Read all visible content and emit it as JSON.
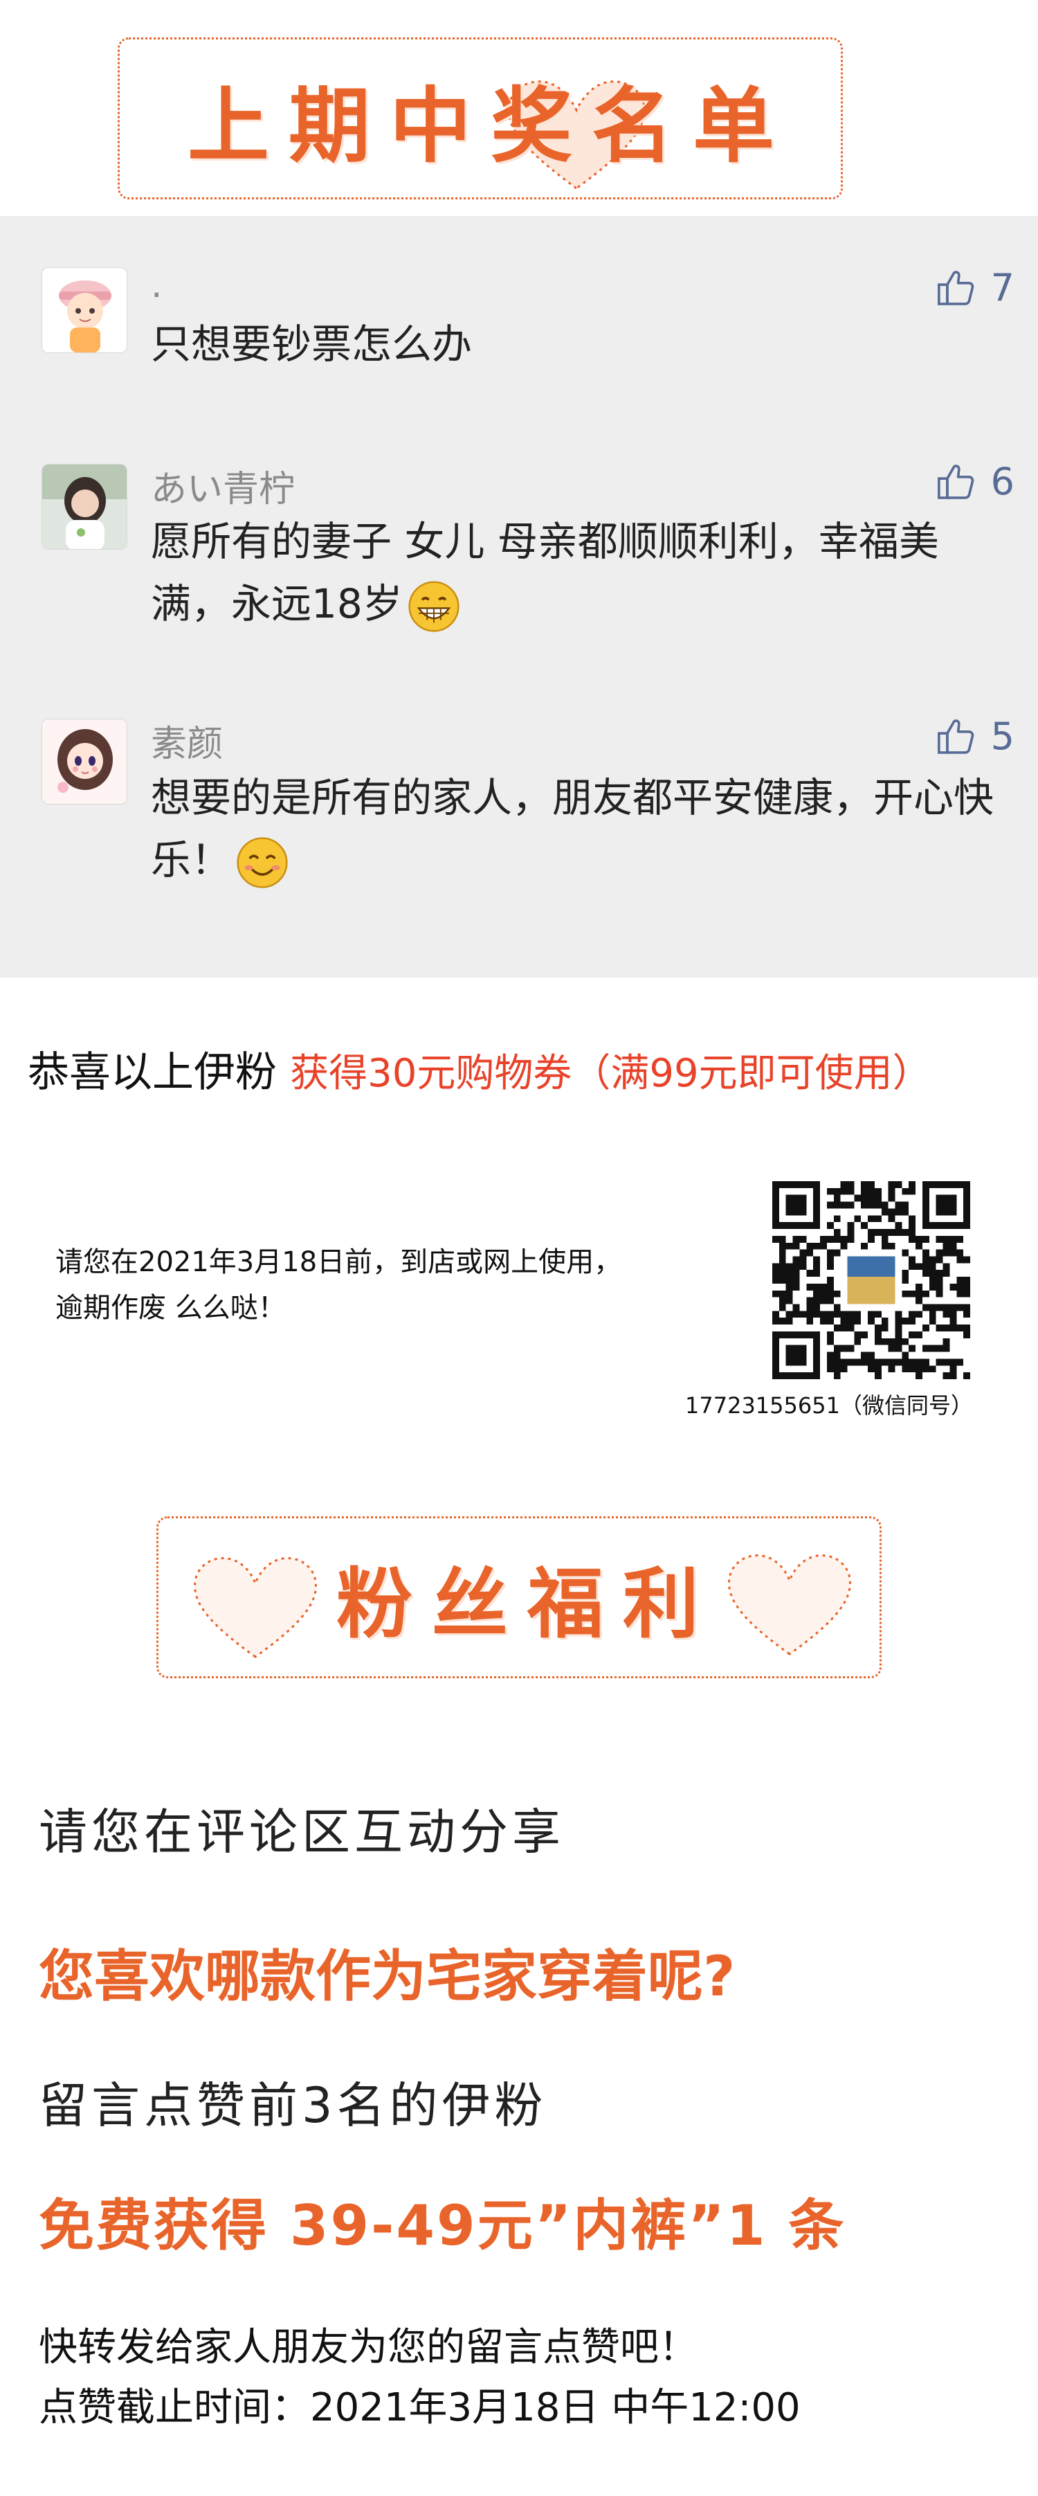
{
  "winners_banner": {
    "title": "上期中奖名单"
  },
  "comments": [
    {
      "nickname": ".",
      "likes": "7",
      "text": "只想要钞票怎么办",
      "avatar_icon": "cartoon-boy-avatar"
    },
    {
      "nickname": "あい青柠",
      "likes": "6",
      "text": "愿所有的妻子 女儿 母亲都顺顺利利，幸福美满，永远18岁",
      "avatar_icon": "girl-photo-avatar",
      "emoji_icon": "grinning-emoji"
    },
    {
      "nickname": "素颜",
      "likes": "5",
      "text": "想要的是所有的家人，朋友都平安健康，开心快乐！",
      "avatar_icon": "cartoon-girl-avatar",
      "emoji_icon": "smiling-emoji"
    }
  ],
  "congrats": {
    "prefix": "恭喜以上伊粉",
    "reward": "获得30元购物券（满99元即可使用）"
  },
  "voucher": {
    "note_line1": "请您在2021年3月18日前，到店或网上使用，",
    "note_line2": "逾期作废  么么哒！",
    "qr_caption": "17723155651（微信同号）"
  },
  "welfare_banner": {
    "title": "粉丝福利"
  },
  "welfare": {
    "invite": "请您在评论区互动分享",
    "question": "您喜欢哪款作为宅家穿着呢?",
    "rule": "留言点赞前3名的伊粉",
    "prize": "免费获得 39-49元”内裤”1 条",
    "share": "快转发给家人朋友为您的留言点赞吧！",
    "deadline": "点赞截止时间：2021年3月18日 中午12:00"
  },
  "colors": {
    "accent": "#e8642a",
    "reward_red": "#e8432a",
    "panel_bg": "#eeeeee",
    "like_blue": "#576b95"
  }
}
